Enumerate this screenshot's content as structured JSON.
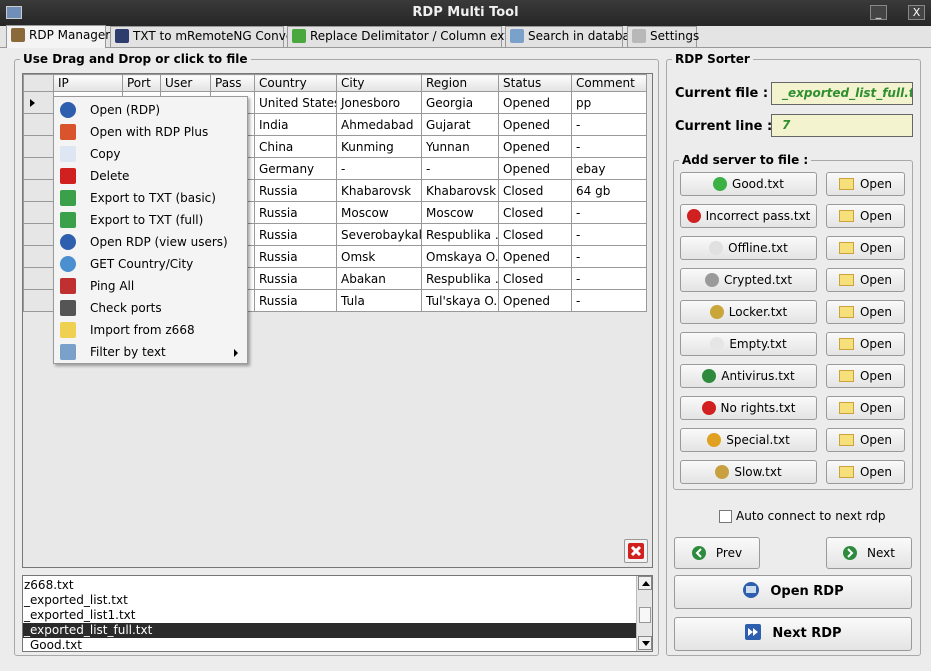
{
  "window": {
    "title": "RDP Multi Tool",
    "minimize": "_",
    "close": "X"
  },
  "tabs": [
    {
      "label": "RDP Manager",
      "icon": "database-icon",
      "color": "#8a6a3a"
    },
    {
      "label": "TXT to mRemoteNG Converter",
      "icon": "mremote-icon",
      "color": "#2d3e6e"
    },
    {
      "label": "Replace Delimitator / Column extractor",
      "icon": "refresh-icon",
      "color": "#4aa83e"
    },
    {
      "label": "Search in database",
      "icon": "search-icon",
      "color": "#7aa1c9"
    },
    {
      "label": "Settings",
      "icon": "wrench-icon",
      "color": "#b8b8b8"
    }
  ],
  "left": {
    "group_label": "Use Drag and Drop or click to file",
    "columns": [
      "IP",
      "Port",
      "User",
      "Pass",
      "Country",
      "City",
      "Region",
      "Status",
      "Comment"
    ],
    "rows": [
      [
        "",
        "",
        "",
        "",
        "United States",
        "Jonesboro",
        "Georgia",
        "Opened",
        "pp"
      ],
      [
        "",
        "",
        "",
        "",
        "India",
        "Ahmedabad",
        "Gujarat",
        "Opened",
        "-"
      ],
      [
        "",
        "",
        "",
        "",
        "China",
        "Kunming",
        "Yunnan",
        "Opened",
        "-"
      ],
      [
        "",
        "",
        "",
        "",
        "Germany",
        "-",
        "-",
        "Opened",
        "ebay"
      ],
      [
        "",
        "",
        "",
        "",
        "Russia",
        "Khabarovsk",
        "Khabarovsk",
        "Closed",
        "64 gb"
      ],
      [
        "",
        "",
        "",
        "",
        "Russia",
        "Moscow",
        "Moscow",
        "Closed",
        "-"
      ],
      [
        "",
        "",
        "",
        "",
        "Russia",
        "Severobaykal'sk",
        "Respublika ...",
        "Closed",
        "-"
      ],
      [
        "",
        "",
        "",
        "",
        "Russia",
        "Omsk",
        "Omskaya O...",
        "Opened",
        "-"
      ],
      [
        "",
        "",
        "",
        "",
        "Russia",
        "Abakan",
        "Respublika ...",
        "Closed",
        "-"
      ],
      [
        "",
        "",
        "",
        "",
        "Russia",
        "Tula",
        "Tul'skaya O...",
        "Opened",
        "-"
      ]
    ],
    "files": [
      "z668.txt",
      "_exported_list.txt",
      "_exported_list1.txt",
      "_exported_list_full.txt",
      "_Good.txt"
    ],
    "selected_file_index": 3
  },
  "context_menu": [
    {
      "label": "Open (RDP)",
      "icon": "rdp-icon",
      "color": "#2d5fae"
    },
    {
      "label": "Open with RDP Plus",
      "icon": "windows-icon",
      "color": "#d9532c"
    },
    {
      "label": "Copy",
      "icon": "copy-icon",
      "color": "#dfe6f3"
    },
    {
      "label": "Delete",
      "icon": "delete-icon",
      "color": "#d12020"
    },
    {
      "label": "Export to TXT (basic)",
      "icon": "export-icon",
      "color": "#3aa04a"
    },
    {
      "label": "Export to TXT (full)",
      "icon": "export-icon",
      "color": "#3aa04a"
    },
    {
      "label": "Open RDP (view users)",
      "icon": "users-icon",
      "color": "#2d5fae"
    },
    {
      "label": "GET Country/City",
      "icon": "globe-icon",
      "color": "#4a8fd0"
    },
    {
      "label": "Ping All",
      "icon": "antenna-icon",
      "color": "#c03030"
    },
    {
      "label": "Check ports",
      "icon": "usb-icon",
      "color": "#555555"
    },
    {
      "label": "Import from z668",
      "icon": "folder-icon",
      "color": "#f0d050"
    },
    {
      "label": "Filter by text",
      "icon": "search-icon",
      "color": "#7aa1c9",
      "submenu": true
    }
  ],
  "right": {
    "group_label": "RDP Sorter",
    "current_file_label": "Current file :",
    "current_file_value": "_exported_list_full.t",
    "current_line_label": "Current line :",
    "current_line_value": "7",
    "add_server_label": "Add server to file :",
    "servers": [
      {
        "label": "Good.txt",
        "icon": "check-icon",
        "color": "#3cb043"
      },
      {
        "label": "Incorrect pass.txt",
        "icon": "forbidden-icon",
        "color": "#d12020"
      },
      {
        "label": "Offline.txt",
        "icon": "offline-icon",
        "color": "#e0e0e0"
      },
      {
        "label": "Crypted.txt",
        "icon": "crypted-icon",
        "color": "#9a9a9a"
      },
      {
        "label": "Locker.txt",
        "icon": "lock-icon",
        "color": "#c9a63a"
      },
      {
        "label": "Empty.txt",
        "icon": "empty-icon",
        "color": "#e6e6e6"
      },
      {
        "label": "Antivirus.txt",
        "icon": "shield-icon",
        "color": "#2e8b3e"
      },
      {
        "label": "No rights.txt",
        "icon": "stop-icon",
        "color": "#d12020"
      },
      {
        "label": "Special.txt",
        "icon": "special-icon",
        "color": "#e0a020"
      },
      {
        "label": "Slow.txt",
        "icon": "snail-icon",
        "color": "#c9a040"
      }
    ],
    "open_label": "Open",
    "auto_connect_label": "Auto connect to next rdp",
    "auto_connect_checked": false,
    "prev_label": "Prev",
    "next_label": "Next",
    "open_rdp_label": "Open RDP",
    "next_rdp_label": "Next RDP"
  }
}
